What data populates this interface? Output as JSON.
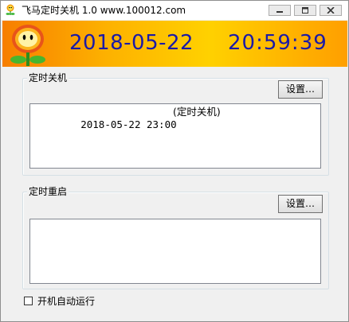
{
  "window": {
    "title": "飞马定时关机 1.0  www.100012.com",
    "controls": {
      "minimize_icon": "minimize-icon",
      "maximize_icon": "maximize-icon",
      "close_icon": "close-icon"
    }
  },
  "banner": {
    "date": "2018-05-22",
    "time": "20:59:39",
    "logo_icon": "flower-icon",
    "text_color": "#1a1aa8"
  },
  "shutdown_group": {
    "label": "定时关机",
    "settings_button": "设置…",
    "entries": [
      {
        "datetime": "2018-05-22 23:00",
        "description": "(定时关机)"
      }
    ]
  },
  "restart_group": {
    "label": "定时重启",
    "settings_button": "设置…",
    "entries": []
  },
  "autostart": {
    "label": "开机自动运行",
    "checked": false
  }
}
